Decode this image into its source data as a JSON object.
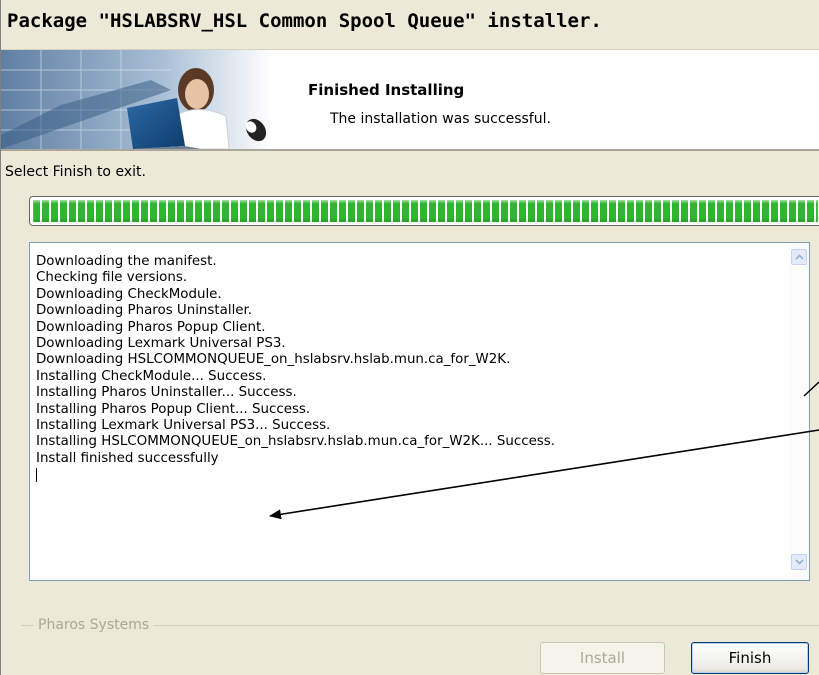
{
  "window": {
    "title": "Package \"HSLABSRV_HSL Common Spool Queue\" installer."
  },
  "header": {
    "title": "Finished Installing",
    "subtitle": "The installation was successful."
  },
  "instruction": "Select Finish to exit.",
  "progress": {
    "fraction": 1.0,
    "color": "#2fb52f"
  },
  "log": {
    "lines": [
      "Downloading the manifest.",
      "Checking file versions.",
      "Downloading CheckModule.",
      "Downloading Pharos Uninstaller.",
      "Downloading Pharos Popup Client.",
      "Downloading Lexmark Universal PS3.",
      "Downloading HSLCOMMONQUEUE_on_hslabsrv.hslab.mun.ca_for_W2K.",
      "Installing CheckModule... Success.",
      "Installing Pharos Uninstaller... Success.",
      "Installing Pharos Popup Client... Success.",
      "Installing Lexmark Universal PS3... Success.",
      "Installing HSLCOMMONQUEUE_on_hslabsrv.hslab.mun.ca_for_W2K... Success.",
      "Install finished successfully"
    ]
  },
  "footer": {
    "group_label": "Pharos Systems",
    "install_label": "Install",
    "finish_label": "Finish"
  },
  "icons": {
    "scroll_up": "chevron-up-icon",
    "scroll_down": "chevron-down-icon",
    "annotation": "arrow-icon"
  }
}
